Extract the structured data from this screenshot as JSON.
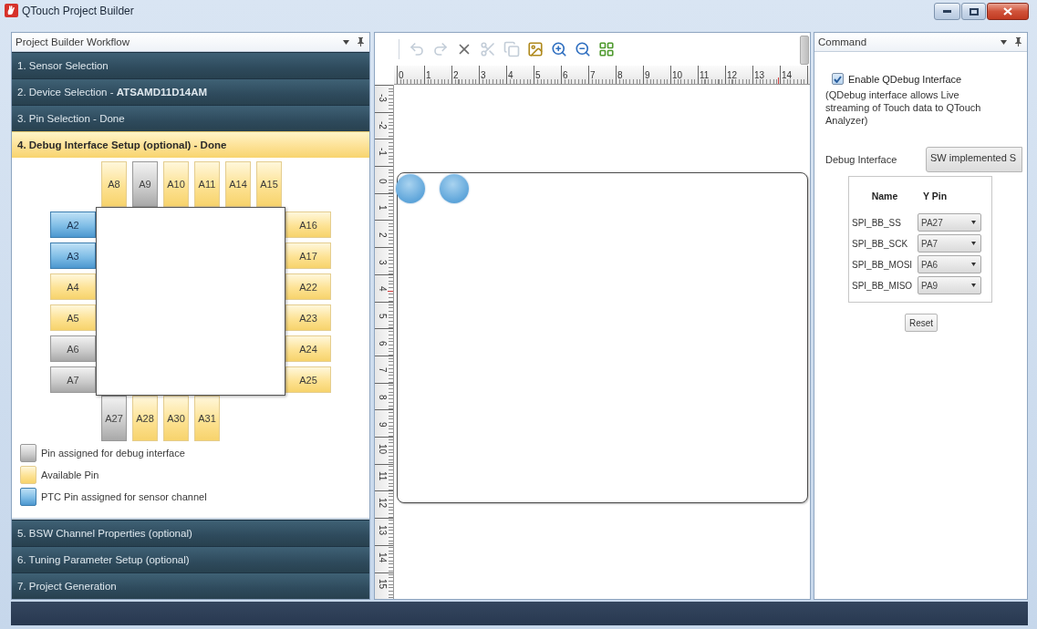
{
  "window": {
    "title": "QTouch Project Builder"
  },
  "workflow_panel": {
    "title": "Project Builder Workflow",
    "steps": [
      {
        "label": "1. Sensor Selection",
        "selected": false
      },
      {
        "label": "2. Device Selection - **ATSAMD11D14AM**",
        "selected": false
      },
      {
        "label": "3. Pin Selection - Done",
        "selected": false
      },
      {
        "label": "4. Debug Interface Setup (optional) - Done",
        "selected": true
      },
      {
        "label": "5. BSW Channel Properties (optional)",
        "selected": false
      },
      {
        "label": "6. Tuning Parameter Setup (optional)",
        "selected": false
      },
      {
        "label": "7. Project Generation",
        "selected": false
      }
    ]
  },
  "pin_diagram": {
    "top_pins": [
      {
        "label": "A8",
        "kind": "available"
      },
      {
        "label": "A9",
        "kind": "debug"
      },
      {
        "label": "A10",
        "kind": "available"
      },
      {
        "label": "A11",
        "kind": "available"
      },
      {
        "label": "A14",
        "kind": "available"
      },
      {
        "label": "A15",
        "kind": "available"
      }
    ],
    "left_pins": [
      {
        "label": "A2",
        "kind": "sensor"
      },
      {
        "label": "A3",
        "kind": "sensor"
      },
      {
        "label": "A4",
        "kind": "available"
      },
      {
        "label": "A5",
        "kind": "available"
      },
      {
        "label": "A6",
        "kind": "debug"
      },
      {
        "label": "A7",
        "kind": "debug"
      }
    ],
    "right_pins": [
      {
        "label": "A16",
        "kind": "available"
      },
      {
        "label": "A17",
        "kind": "available"
      },
      {
        "label": "A22",
        "kind": "available"
      },
      {
        "label": "A23",
        "kind": "available"
      },
      {
        "label": "A24",
        "kind": "available"
      },
      {
        "label": "A25",
        "kind": "available"
      }
    ],
    "bottom_pins": [
      {
        "label": "A27",
        "kind": "debug"
      },
      {
        "label": "A28",
        "kind": "available"
      },
      {
        "label": "A30",
        "kind": "available"
      },
      {
        "label": "A31",
        "kind": "available"
      }
    ],
    "legend": [
      {
        "kind": "debug",
        "label": "Pin assigned for debug interface"
      },
      {
        "kind": "available",
        "label": "Available Pin"
      },
      {
        "kind": "sensor",
        "label": "PTC Pin assigned for sensor channel"
      }
    ]
  },
  "designer": {
    "toolbar": [
      {
        "disabled": true
      },
      {
        "disabled": true
      },
      {
        "disabled": false
      },
      {
        "disabled": true
      },
      {
        "disabled": true
      },
      {
        "disabled": false
      },
      {
        "disabled": false
      },
      {
        "disabled": false
      },
      {
        "disabled": false
      }
    ],
    "horizontal_ruler": {
      "labels": [
        "0",
        "1",
        "2",
        "3",
        "4",
        "5",
        "6",
        "7",
        "8",
        "9",
        "10",
        "11",
        "12",
        "13",
        "14"
      ]
    },
    "vertical_ruler": {
      "labels": [
        "-3",
        "-2",
        "-1",
        "0",
        "1",
        "2",
        "3",
        "4",
        "5",
        "6",
        "7",
        "8",
        "9",
        "10",
        "11",
        "12",
        "13",
        "14",
        "15"
      ]
    }
  },
  "command_panel": {
    "title": "Command",
    "enable_qdebug": {
      "label": "Enable QDebug Interface",
      "checked": true
    },
    "description": "(QDebug interface allows Live streaming of Touch data to QTouch Analyzer)",
    "debug_interface": {
      "label": "Debug Interface",
      "value": "SW implemented S"
    },
    "pin_table": {
      "columns": [
        "Name",
        "Y Pin"
      ],
      "rows": [
        {
          "name": "SPI_BB_SS",
          "y_pin": "PA27"
        },
        {
          "name": "SPI_BB_SCK",
          "y_pin": "PA7"
        },
        {
          "name": "SPI_BB_MOSI",
          "y_pin": "PA6"
        },
        {
          "name": "SPI_BB_MISO",
          "y_pin": "PA9"
        }
      ]
    },
    "reset_button": "Reset"
  }
}
